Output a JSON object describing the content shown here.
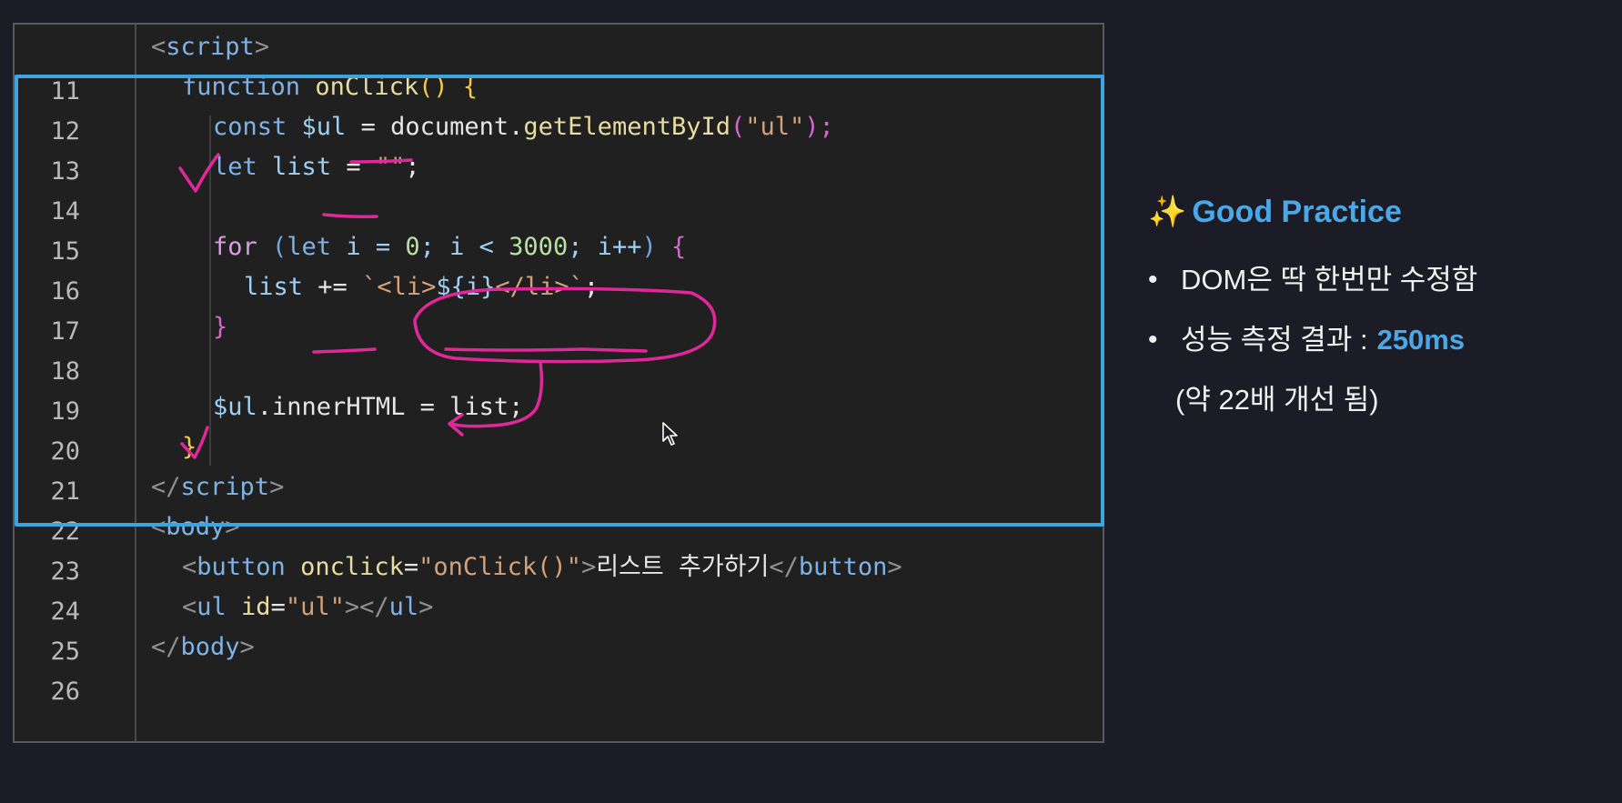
{
  "editor": {
    "lines": [
      {
        "n": "11"
      },
      {
        "n": "12"
      },
      {
        "n": "13"
      },
      {
        "n": "14"
      },
      {
        "n": "15"
      },
      {
        "n": "16"
      },
      {
        "n": "17"
      },
      {
        "n": "18"
      },
      {
        "n": "19"
      },
      {
        "n": "20"
      },
      {
        "n": "21"
      },
      {
        "n": "22"
      },
      {
        "n": "23"
      },
      {
        "n": "24"
      },
      {
        "n": "25"
      },
      {
        "n": "26"
      }
    ],
    "code": {
      "l11_open": "<",
      "l11_tag": "script",
      "l11_close": ">",
      "l12_kw": "function",
      "l12_fn": "onClick",
      "l12_paren": "()",
      "l12_brace": "{",
      "l13_kw": "const",
      "l13_var": "$ul",
      "l13_eq": " = document.",
      "l13_fn": "getElementById",
      "l13_p1": "(",
      "l13_str": "\"ul\"",
      "l13_p2": ");",
      "l14_kw": "let",
      "l14_var": "list",
      "l14_eq": " = ",
      "l14_str": "\"\"",
      "l14_end": ";",
      "l16_kw": "for",
      "l16_p1": " (",
      "l16_kw2": "let",
      "l16_i": " i = ",
      "l16_zero": "0",
      "l16_mid": "; i < ",
      "l16_num": "3000",
      "l16_inc": "; i++",
      "l16_p2": ")",
      "l16_brace": " {",
      "l17_var": "list",
      "l17_op": " += ",
      "l17_str": "`<li>",
      "l17_tpl": "${i}",
      "l17_str2": "</li>`",
      "l17_end": ";",
      "l18_brace": "}",
      "l20_var": "$ul",
      "l20_rest": ".innerHTML = list;",
      "l21_brace": "}",
      "l22_open": "</",
      "l22_tag": "script",
      "l22_close": ">",
      "l23_open": "<",
      "l23_tag": "body",
      "l23_close": ">",
      "l24_open": "<",
      "l24_tag": "button",
      "l24_attr": " onclick",
      "l24_eq": "=",
      "l24_val": "\"onClick()\"",
      "l24_gt": ">",
      "l24_text": "리스트 추가하기",
      "l24_end_open": "</",
      "l24_end_tag": "button",
      "l24_end_close": ">",
      "l25_open": "<",
      "l25_tag": "ul",
      "l25_attr": " id",
      "l25_eq": "=",
      "l25_val": "\"ul\"",
      "l25_gt": "></",
      "l25_tag2": "ul",
      "l25_close": ">",
      "l26_open": "</",
      "l26_tag": "body",
      "l26_close": ">"
    }
  },
  "panel": {
    "sparkle": "✨",
    "title": "Good Practice",
    "bullet1": "DOM은 딱 한번만 수정함",
    "bullet2_label": "성능 측정 결과 :",
    "bullet2_value": "250ms",
    "bullet2_note": "(약 22배 개선 됨)",
    "bullet_glyph": "•"
  },
  "colors": {
    "highlight_box": "#3aa5e0",
    "annotation_pen": "#e0289a",
    "accent_text": "#4aa8e8"
  }
}
